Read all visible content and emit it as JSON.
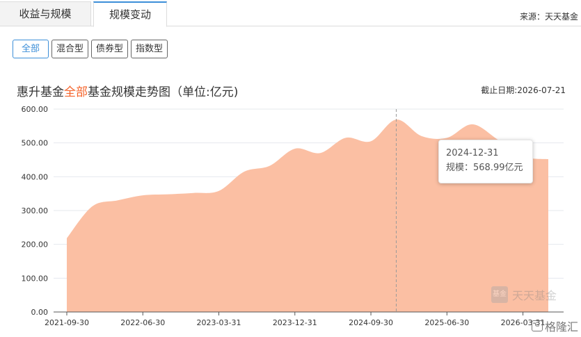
{
  "tabs": [
    {
      "label": "收益与规模",
      "active": false
    },
    {
      "label": "规模变动",
      "active": true
    }
  ],
  "source": "来源：天天基金",
  "filters": [
    {
      "label": "全部",
      "active": true
    },
    {
      "label": "混合型",
      "active": false
    },
    {
      "label": "债券型",
      "active": false
    },
    {
      "label": "指数型",
      "active": false
    }
  ],
  "title": {
    "prefix": "惠升基金",
    "highlight": "全部",
    "suffix": "基金规模走势图（单位:亿元)"
  },
  "deadline": "截止日期:2026-07-21",
  "tooltip": {
    "date": "2024-12-31",
    "value_text": "规模：568.99亿元"
  },
  "watermark": {
    "logo": "基金",
    "text": "天天基金"
  },
  "corner_watermark": {
    "text": "格隆汇"
  },
  "colors": {
    "area_fill": "#fbbfa3",
    "highlight": "#f5632a",
    "accent": "#3b8ed8"
  },
  "chart_data": {
    "type": "area",
    "x": [
      "2021-09-30",
      "2021-12-31",
      "2022-03-31",
      "2022-06-30",
      "2022-09-30",
      "2022-12-31",
      "2023-03-31",
      "2023-06-30",
      "2023-09-30",
      "2023-12-31",
      "2024-03-31",
      "2024-06-30",
      "2024-09-30",
      "2024-12-31",
      "2025-03-31",
      "2025-06-30",
      "2025-09-30",
      "2025-12-31",
      "2026-03-31",
      "2026-06-30"
    ],
    "values": [
      218,
      312,
      330,
      345,
      348,
      352,
      358,
      415,
      432,
      483,
      470,
      515,
      505,
      568.99,
      520,
      515,
      555,
      510,
      460,
      452
    ],
    "x_ticks": [
      "2021-09-30",
      "2022-06-30",
      "2023-03-31",
      "2023-12-31",
      "2024-09-30",
      "2025-06-30",
      "2026-03-31"
    ],
    "y_ticks": [
      "0.00",
      "100.00",
      "200.00",
      "300.00",
      "400.00",
      "500.00",
      "600.00"
    ],
    "ylim": [
      0,
      600
    ],
    "grid": true,
    "highlight_index": 13
  }
}
